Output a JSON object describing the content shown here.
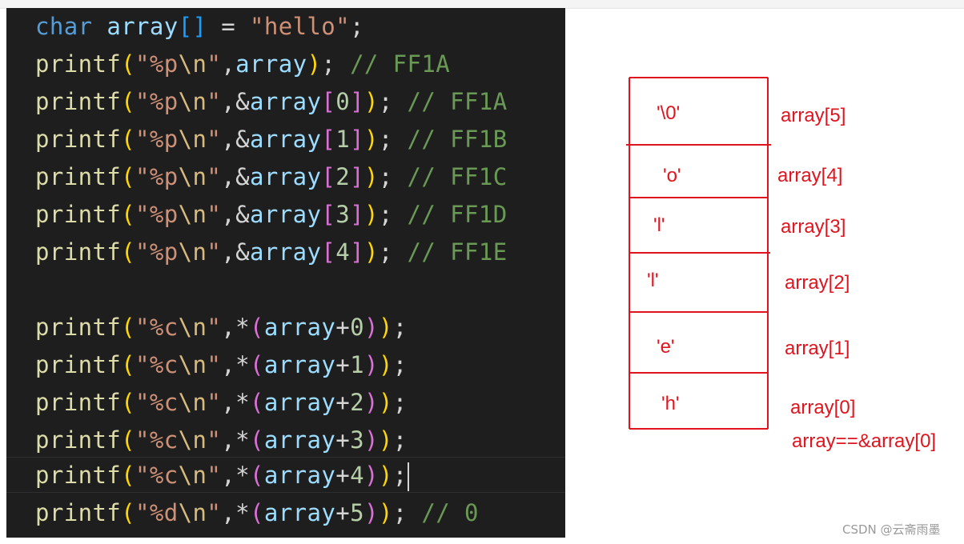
{
  "code": {
    "line1": {
      "kw": "char",
      "var": "array",
      "lb": "[",
      "rb": "]",
      "eq": " = ",
      "str": "\"hello\"",
      "semi": ";"
    },
    "printf": "printf",
    "fmt_p": "%p",
    "fmt_c": "%c",
    "fmt_d": "%d",
    "newline": "\\n",
    "quote": "\"",
    "comments": {
      "c1": "// FF1A",
      "c2": "// FF1A",
      "c3": "// FF1B",
      "c4": "// FF1C",
      "c5": "// FF1D",
      "c6": "// FF1E",
      "c14": "// 0"
    },
    "indices": [
      "0",
      "1",
      "2",
      "3",
      "4",
      "5"
    ]
  },
  "diagram": {
    "cells": [
      "'\\0'",
      "'o'",
      "'l'",
      "'l'",
      "'e'",
      "'h'"
    ],
    "labels": [
      "array[5]",
      "array[4]",
      "array[3]",
      "array[2]",
      "array[1]",
      "array[0]"
    ],
    "note": "array==&array[0]",
    "accent": "#e0141e"
  },
  "watermark": "CSDN @云斋雨墨"
}
